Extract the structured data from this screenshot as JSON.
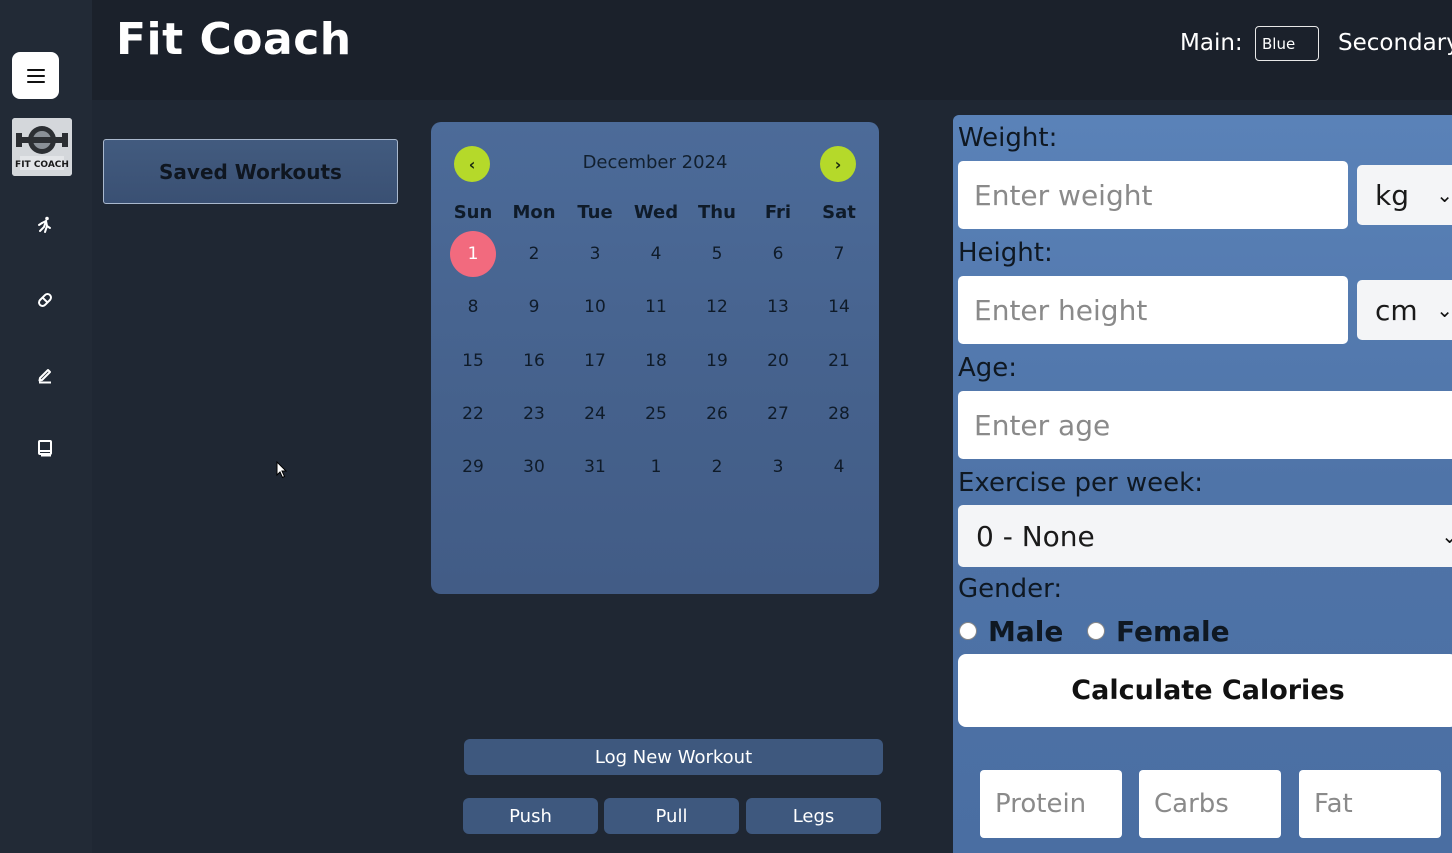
{
  "app": {
    "title": "Fit Coach"
  },
  "theme": {
    "main_label": "Main:",
    "main_value": "Blue",
    "secondary_label": "Secondary:"
  },
  "sidebar": {
    "logo_text": "FIT COACH",
    "icons": [
      "menu-icon",
      "running-icon",
      "pill-icon",
      "pencil-icon",
      "book-icon"
    ]
  },
  "saved_workouts": {
    "label": "Saved Workouts"
  },
  "calendar": {
    "prev": "‹",
    "next": "›",
    "month_label": "December 2024",
    "weekdays": [
      "Sun",
      "Mon",
      "Tue",
      "Wed",
      "Thu",
      "Fri",
      "Sat"
    ],
    "weeks": [
      [
        "1",
        "2",
        "3",
        "4",
        "5",
        "6",
        "7"
      ],
      [
        "8",
        "9",
        "10",
        "11",
        "12",
        "13",
        "14"
      ],
      [
        "15",
        "16",
        "17",
        "18",
        "19",
        "20",
        "21"
      ],
      [
        "22",
        "23",
        "24",
        "25",
        "26",
        "27",
        "28"
      ],
      [
        "29",
        "30",
        "31",
        "1",
        "2",
        "3",
        "4"
      ]
    ],
    "today": "1"
  },
  "workout": {
    "log_label": "Log New Workout",
    "types": [
      "Push",
      "Pull",
      "Legs"
    ]
  },
  "form": {
    "weight_label": "Weight:",
    "weight_placeholder": "Enter weight",
    "weight_unit": "kg",
    "height_label": "Height:",
    "height_placeholder": "Enter height",
    "height_unit": "cm",
    "age_label": "Age:",
    "age_placeholder": "Enter age",
    "exercise_label": "Exercise per week:",
    "exercise_value": "0 - None",
    "gender_label": "Gender:",
    "gender_options": [
      "Male",
      "Female"
    ],
    "calc_label": "Calculate Calories",
    "macros": [
      "Protein",
      "Carbs",
      "Fat"
    ]
  },
  "colors": {
    "accent_green": "#b5d92a",
    "today_pink": "#f26a7e",
    "panel_blue": "#4f74a8"
  }
}
